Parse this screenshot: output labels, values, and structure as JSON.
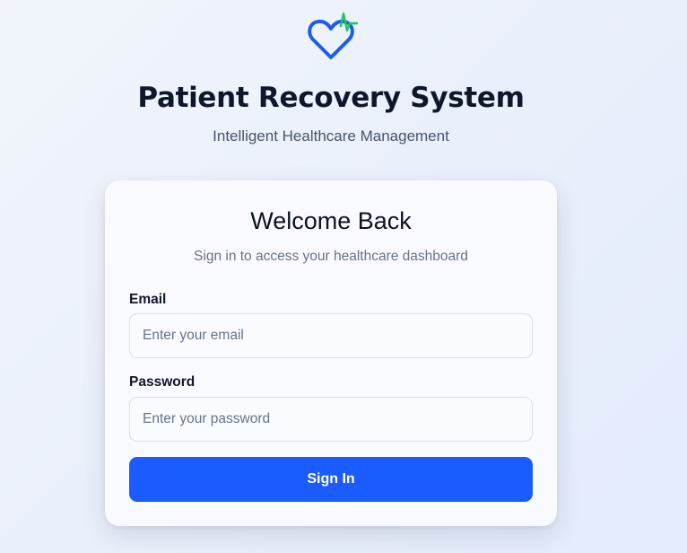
{
  "header": {
    "logo_icon": "heart-pulse-icon",
    "title": "Patient Recovery System",
    "subtitle": "Intelligent Healthcare Management"
  },
  "login": {
    "title": "Welcome Back",
    "subtitle": "Sign in to access your healthcare dashboard",
    "email_label": "Email",
    "email_placeholder": "Enter your email",
    "email_value": "",
    "password_label": "Password",
    "password_placeholder": "Enter your password",
    "password_value": "",
    "submit_label": "Sign In"
  },
  "colors": {
    "primary": "#1a5cff",
    "heart": "#1d5cf0",
    "pulse": "#22c55e",
    "title": "#0f172a",
    "muted": "#64748b"
  }
}
